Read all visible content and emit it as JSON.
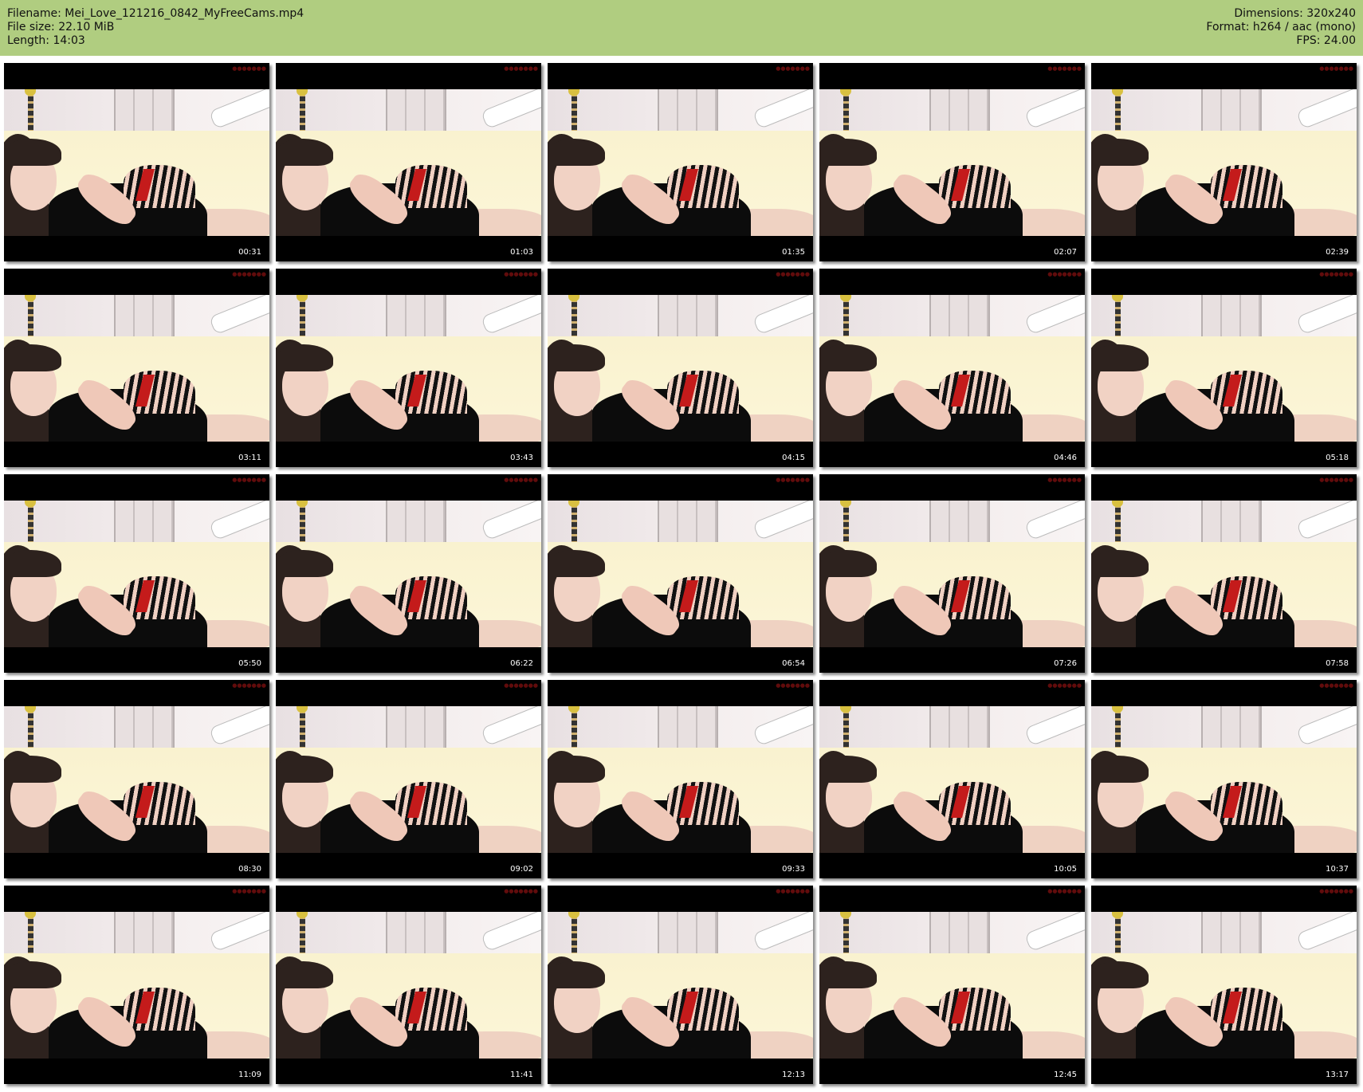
{
  "header": {
    "left": [
      "Filename: Mei_Love_121216_0842_MyFreeCams.mp4",
      "File size: 22.10 MiB",
      "Length: 14:03"
    ],
    "right": [
      "Dimensions: 320x240",
      "Format: h264 / aac (mono)",
      "FPS: 24.00"
    ]
  },
  "thumbnails": [
    {
      "time": "00:31"
    },
    {
      "time": "01:03"
    },
    {
      "time": "01:35"
    },
    {
      "time": "02:07"
    },
    {
      "time": "02:39"
    },
    {
      "time": "03:11"
    },
    {
      "time": "03:43"
    },
    {
      "time": "04:15"
    },
    {
      "time": "04:46"
    },
    {
      "time": "05:18"
    },
    {
      "time": "05:50"
    },
    {
      "time": "06:22"
    },
    {
      "time": "06:54"
    },
    {
      "time": "07:26"
    },
    {
      "time": "07:58"
    },
    {
      "time": "08:30"
    },
    {
      "time": "09:02"
    },
    {
      "time": "09:33"
    },
    {
      "time": "10:05"
    },
    {
      "time": "10:37"
    },
    {
      "time": "11:09"
    },
    {
      "time": "11:41"
    },
    {
      "time": "12:13"
    },
    {
      "time": "12:45"
    },
    {
      "time": "13:17"
    }
  ],
  "colors": {
    "header_bg": "#b0cd80",
    "watermark": "#7a0f0f"
  }
}
